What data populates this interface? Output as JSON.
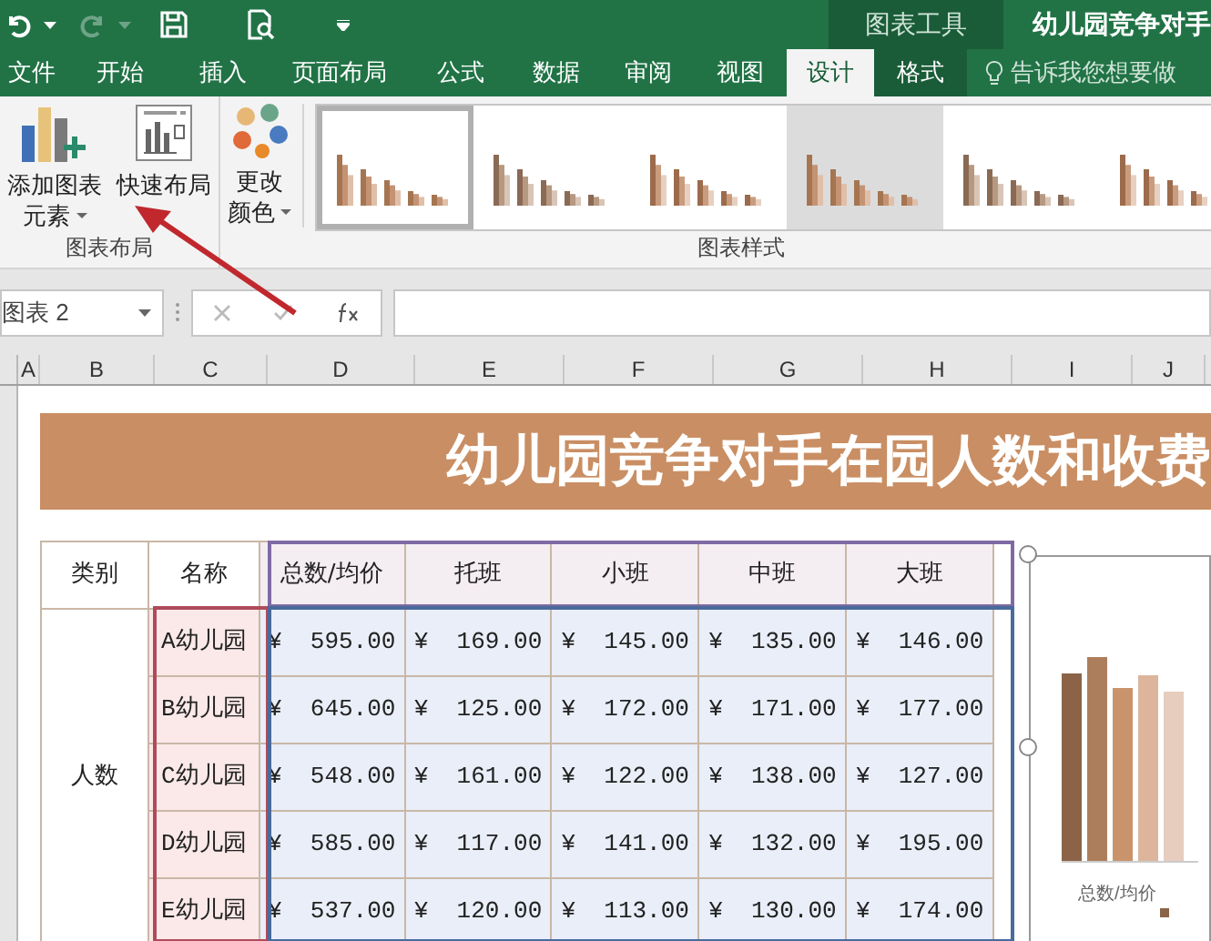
{
  "title_bar": {
    "context_label": "图表工具",
    "title": "幼儿园竞争对手"
  },
  "tabs": [
    {
      "label": "文件",
      "selected": false,
      "contextual": false
    },
    {
      "label": "开始",
      "selected": false,
      "contextual": false
    },
    {
      "label": "插入",
      "selected": false,
      "contextual": false
    },
    {
      "label": "页面布局",
      "selected": false,
      "contextual": false
    },
    {
      "label": "公式",
      "selected": false,
      "contextual": false
    },
    {
      "label": "数据",
      "selected": false,
      "contextual": false
    },
    {
      "label": "审阅",
      "selected": false,
      "contextual": false
    },
    {
      "label": "视图",
      "selected": false,
      "contextual": false
    },
    {
      "label": "设计",
      "selected": true,
      "contextual": true
    },
    {
      "label": "格式",
      "selected": false,
      "contextual": true
    }
  ],
  "tell_me": {
    "placeholder": "告诉我您想要做"
  },
  "ribbon": {
    "groups": [
      {
        "label": "图表布局",
        "buttons": [
          {
            "kind": "add_element",
            "lines": [
              "添加图表",
              "元素"
            ]
          },
          {
            "kind": "quick_layout",
            "lines": [
              "快速布局"
            ]
          }
        ]
      },
      {
        "label": "图表样式",
        "buttons": [
          {
            "kind": "colors",
            "lines": [
              "更改",
              "颜色"
            ]
          }
        ],
        "styles": [
          {
            "selected": true
          },
          {
            "selected": false
          },
          {
            "selected": false
          },
          {
            "selected": false
          },
          {
            "selected": false
          },
          {
            "selected": false
          }
        ]
      }
    ]
  },
  "formula_bar": {
    "name_box": "图表 2"
  },
  "column_headers": [
    "A",
    "B",
    "C",
    "D",
    "E",
    "F",
    "G",
    "H",
    "I",
    "J"
  ],
  "banner": {
    "title": "幼儿园竞争对手在园人数和收费"
  },
  "table": {
    "columns": [
      "类别",
      "名称",
      "总数/均价",
      "托班",
      "小班",
      "中班",
      "大班"
    ],
    "category": "人数",
    "rows": [
      {
        "name": "A幼儿园",
        "values": [
          "¥  595.00",
          "¥  169.00",
          "¥  145.00",
          "¥  135.00",
          "¥  146.00"
        ]
      },
      {
        "name": "B幼儿园",
        "values": [
          "¥  645.00",
          "¥  125.00",
          "¥  172.00",
          "¥  171.00",
          "¥  177.00"
        ]
      },
      {
        "name": "C幼儿园",
        "values": [
          "¥  548.00",
          "¥  161.00",
          "¥  122.00",
          "¥  138.00",
          "¥  127.00"
        ]
      },
      {
        "name": "D幼儿园",
        "values": [
          "¥  585.00",
          "¥  117.00",
          "¥  141.00",
          "¥  132.00",
          "¥  195.00"
        ]
      },
      {
        "name": "E幼儿园",
        "values": [
          "¥  537.00",
          "¥  120.00",
          "¥  113.00",
          "¥  130.00",
          "¥  174.00"
        ]
      }
    ]
  },
  "chart": {
    "axis_label": "总数/均价"
  }
}
